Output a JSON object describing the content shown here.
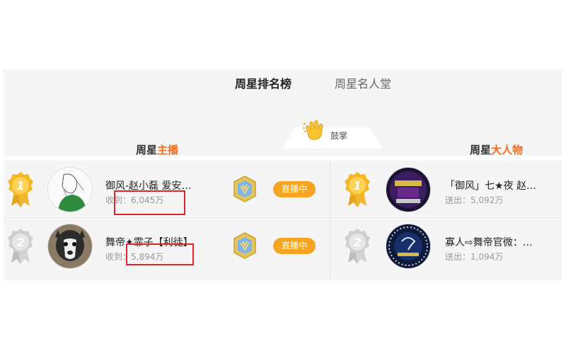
{
  "tabs": {
    "active": "周星排名榜",
    "inactive": "周星名人堂"
  },
  "clap": {
    "label": "鼓掌"
  },
  "columns": {
    "left": {
      "prefix": "周星",
      "highlight": "主播"
    },
    "right": {
      "prefix": "周星",
      "highlight": "大人物"
    }
  },
  "anchors": [
    {
      "rank": "1",
      "name": "御风-赵小磊 爱安…",
      "stat": "收到：6,045万",
      "live": "直播中"
    },
    {
      "rank": "2",
      "name": "舞帝✦霏子【利徒】",
      "stat": "收到：5,894万",
      "live": "直播中"
    }
  ],
  "patrons": [
    {
      "rank": "1",
      "name": "「御风」七★夜 赵…",
      "stat": "送出：5,092万"
    },
    {
      "rank": "2",
      "name": "寡人⇨舞帝官微：…",
      "stat": "送出：1,094万"
    }
  ],
  "colors": {
    "gold": "#f5b722",
    "silver": "#cfcfcf",
    "live": "#f6a623",
    "highlight": "#ff6a1a",
    "annotation": "#e0242a"
  },
  "icons": [
    "clap-icon",
    "gold-medal-icon",
    "silver-medal-icon",
    "level-badge-icon"
  ]
}
